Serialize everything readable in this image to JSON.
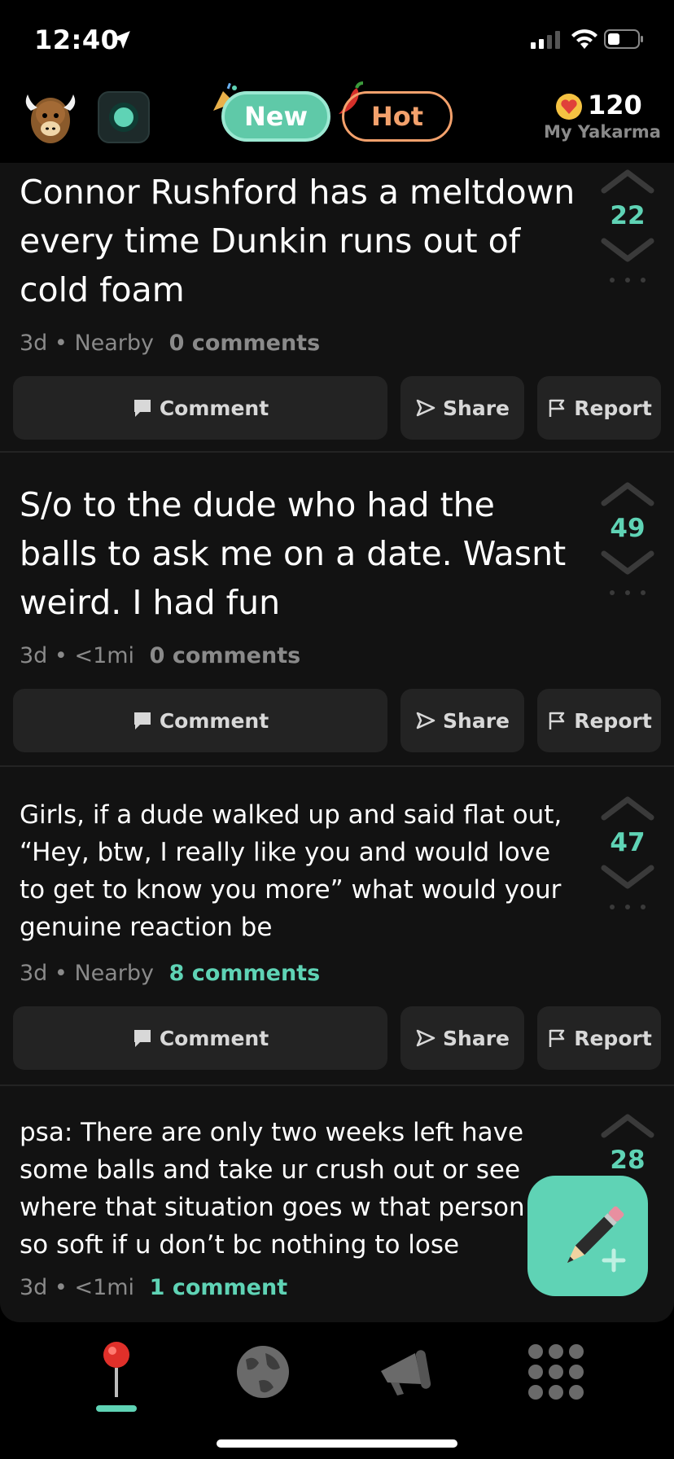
{
  "status_bar": {
    "time": "12:40"
  },
  "header": {
    "tabs": [
      {
        "label": "New",
        "active": true
      },
      {
        "label": "Hot",
        "active": false
      }
    ],
    "karma": {
      "value": "120",
      "label": "My Yakarma"
    }
  },
  "posts": [
    {
      "text": "Connor Rushford has a meltdown every time Dunkin runs out of cold foam",
      "score": "22",
      "age": "3d",
      "location": "Nearby",
      "comments": "0 comments"
    },
    {
      "text": "S/o to the dude who had the balls to ask me on a date. Wasnt weird. I had fun",
      "score": "49",
      "age": "3d",
      "location": "<1mi",
      "comments": "0 comments"
    },
    {
      "text": "Girls, if a dude walked up and said flat out, “Hey, btw, I really like you and would love to get to know you more” what would your genuine reaction be",
      "score": "47",
      "age": "3d",
      "location": "Nearby",
      "comments": "8 comments"
    },
    {
      "text": "psa: There are only two weeks left have some balls and take ur crush out or see where that situation goes w that person u so soft if u don’t bc nothing to lose",
      "score": "28",
      "age": "3d",
      "location": "<1mi",
      "comments": "1 comment"
    }
  ],
  "actions": {
    "comment": "Comment",
    "share": "Share",
    "report": "Report"
  },
  "meta_separator": "•",
  "colors": {
    "accent": "#5fd3b5",
    "hot": "#f3a16c",
    "background": "#121212",
    "button": "#232323"
  },
  "icons": {
    "nav": [
      "pin-icon",
      "globe-icon",
      "megaphone-icon",
      "grid-icon"
    ],
    "fab": "pencil-plus-icon"
  }
}
